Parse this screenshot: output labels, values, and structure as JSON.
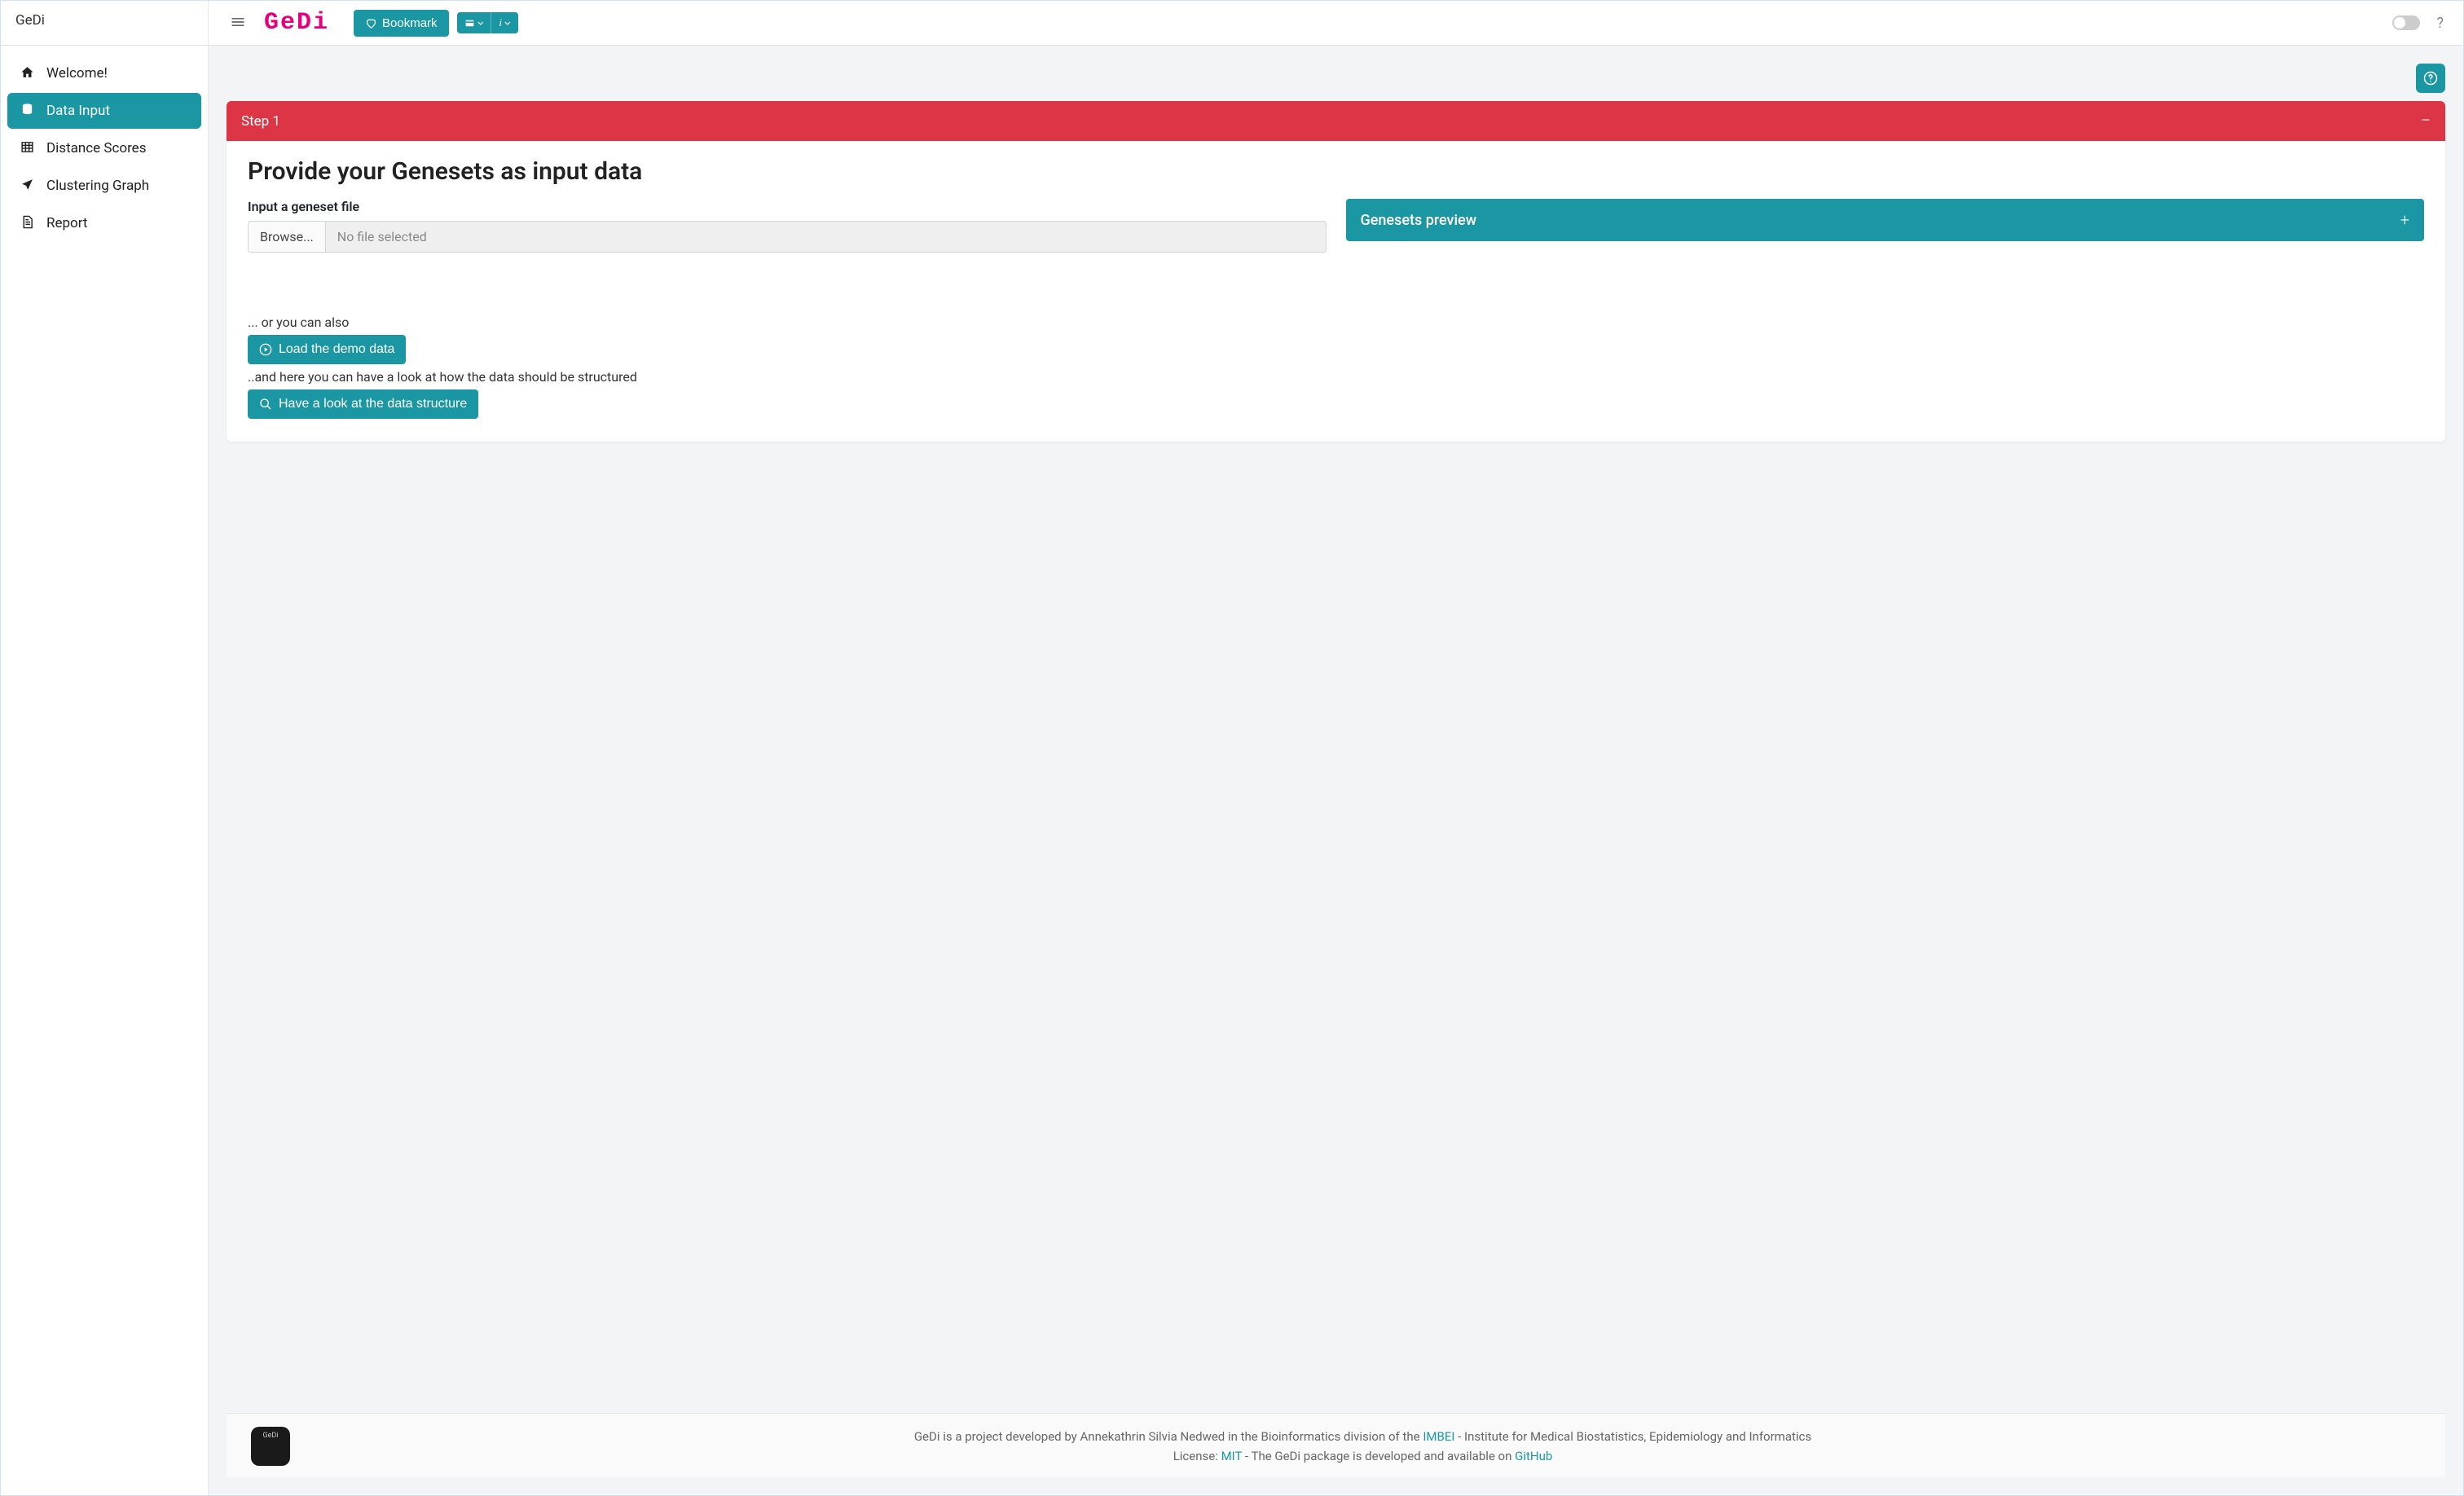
{
  "app": {
    "name": "GeDi",
    "logo": "GeDi"
  },
  "topbar": {
    "bookmark_label": "Bookmark"
  },
  "sidebar": {
    "items": [
      {
        "label": "Welcome!",
        "icon": "home",
        "active": false
      },
      {
        "label": "Data Input",
        "icon": "database",
        "active": true
      },
      {
        "label": "Distance Scores",
        "icon": "table",
        "active": false
      },
      {
        "label": "Clustering Graph",
        "icon": "arrow",
        "active": false
      },
      {
        "label": "Report",
        "icon": "file",
        "active": false
      }
    ]
  },
  "step": {
    "header": "Step 1",
    "title": "Provide your Genesets as input data",
    "input_label": "Input a geneset file",
    "browse_label": "Browse...",
    "file_placeholder": "No file selected",
    "or_text": "... or you can also",
    "demo_button": "Load the demo data",
    "structure_hint": "..and here you can have a look at how the data should be structured",
    "structure_button": "Have a look at the data structure",
    "preview_header": "Genesets preview"
  },
  "footer": {
    "line1_pre": "GeDi is a project developed by Annekathrin Silvia Nedwed in the Bioinformatics division of the ",
    "imbei": "IMBEI",
    "line1_post": " - Institute for Medical Biostatistics, Epidemiology and Informatics",
    "line2_pre": "License: ",
    "mit": "MIT",
    "line2_mid": " - The GeDi package is developed and available on ",
    "github": "GitHub"
  }
}
